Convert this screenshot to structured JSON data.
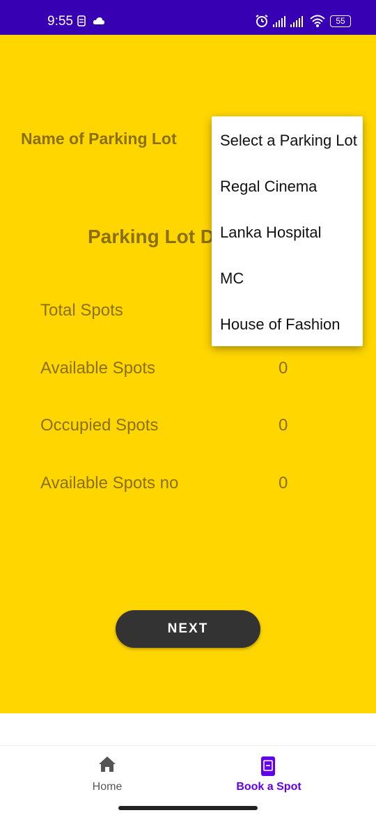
{
  "status_bar": {
    "time": "9:55",
    "battery": "55",
    "background": "#3700b3"
  },
  "form": {
    "lot_label": "Name of Parking Lot",
    "details_title": "Parking Lot Details",
    "rows": [
      {
        "label": "Total Spots",
        "value": ""
      },
      {
        "label": "Available Spots",
        "value": "0"
      },
      {
        "label": "Occupied Spots",
        "value": "0"
      },
      {
        "label": "Available Spots no",
        "value": "0"
      }
    ],
    "background": "#ffd600"
  },
  "dropdown": {
    "options": [
      "Select a Parking Lot",
      "Regal Cinema",
      "Lanka Hospital",
      "MC",
      "House of Fashion"
    ]
  },
  "next_button": {
    "label": "NEXT"
  },
  "bottom_nav": {
    "items": [
      {
        "label": "Home",
        "icon": "home-icon",
        "active": false
      },
      {
        "label": "Book a Spot",
        "icon": "book-spot-icon",
        "active": true
      }
    ],
    "active_color": "#6200ee",
    "inactive_color": "#555555"
  }
}
